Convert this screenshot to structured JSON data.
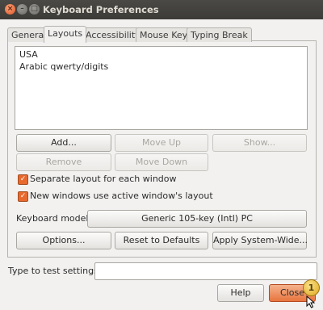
{
  "window": {
    "title": "Keyboard Preferences",
    "controls": {
      "close": "×",
      "minimize": "–",
      "maximize": "□"
    }
  },
  "tabs": [
    {
      "label": "General"
    },
    {
      "label": "Layouts",
      "active": true
    },
    {
      "label": "Accessibility"
    },
    {
      "label": "Mouse Keys"
    },
    {
      "label": "Typing Break"
    }
  ],
  "layouts": {
    "items": [
      "USA",
      "Arabic qwerty/digits"
    ],
    "buttons": {
      "add": "Add...",
      "move_up": "Move Up",
      "show": "Show...",
      "remove": "Remove",
      "move_down": "Move Down"
    },
    "checkboxes": {
      "separate_layout": {
        "label": "Separate layout for each window",
        "checked": true
      },
      "new_windows": {
        "label": "New windows use active window's layout",
        "checked": true
      }
    },
    "keyboard_model_label": "Keyboard model:",
    "keyboard_model_value": "Generic 105-key (Intl) PC",
    "options": "Options...",
    "reset": "Reset to Defaults",
    "apply": "Apply System-Wide..."
  },
  "test": {
    "label": "Type to test settings:",
    "value": ""
  },
  "footer": {
    "help": "Help",
    "close": "Close",
    "badge": "1"
  },
  "colors": {
    "accent": "#e8692e",
    "titlebar": "#3c3b37",
    "badge": "#e0a81d"
  },
  "check_mark": "✓"
}
